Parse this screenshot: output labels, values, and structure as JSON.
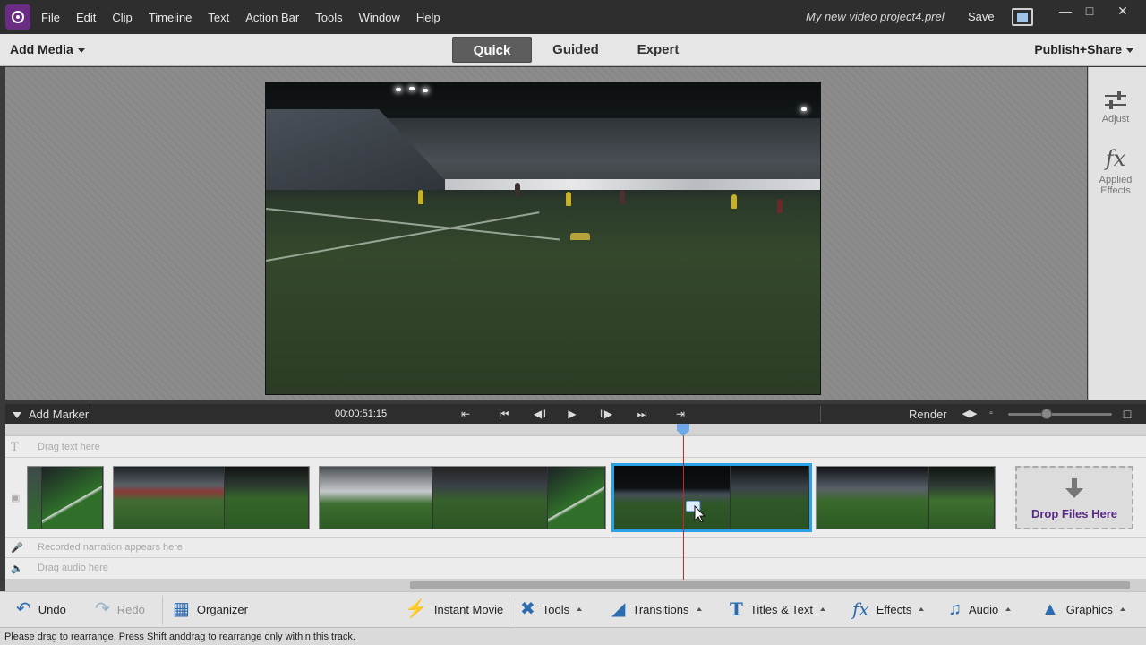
{
  "menubar": {
    "items": [
      "File",
      "Edit",
      "Clip",
      "Timeline",
      "Text",
      "Action Bar",
      "Tools",
      "Window",
      "Help"
    ],
    "project_title": "My new video project4.prel",
    "save_label": "Save"
  },
  "modebar": {
    "add_media": "Add Media",
    "tabs": [
      "Quick",
      "Guided",
      "Expert"
    ],
    "active_tab": "Quick",
    "publish": "Publish+Share"
  },
  "right_panel": {
    "adjust": "Adjust",
    "applied_effects": "Applied Effects"
  },
  "timeline_bar": {
    "add_marker": "Add Marker",
    "timecode": "00:00:51:15",
    "render": "Render"
  },
  "tracks": {
    "text_hint": "Drag text here",
    "narration_hint": "Recorded narration appears here",
    "audio_hint": "Drag audio here",
    "drop_files": "Drop Files Here"
  },
  "actionbar": {
    "undo": "Undo",
    "redo": "Redo",
    "organizer": "Organizer",
    "instant_movie": "Instant Movie",
    "tools": "Tools",
    "transitions": "Transitions",
    "titles_text": "Titles & Text",
    "effects": "Effects",
    "audio": "Audio",
    "graphics": "Graphics"
  },
  "status": {
    "message": "Please drag to rearrange, Press Shift anddrag to rearrange only within this track."
  },
  "colors": {
    "accent_purple": "#6b2d84",
    "selection_blue": "#29a3e6",
    "playhead_red": "#c8262b"
  }
}
